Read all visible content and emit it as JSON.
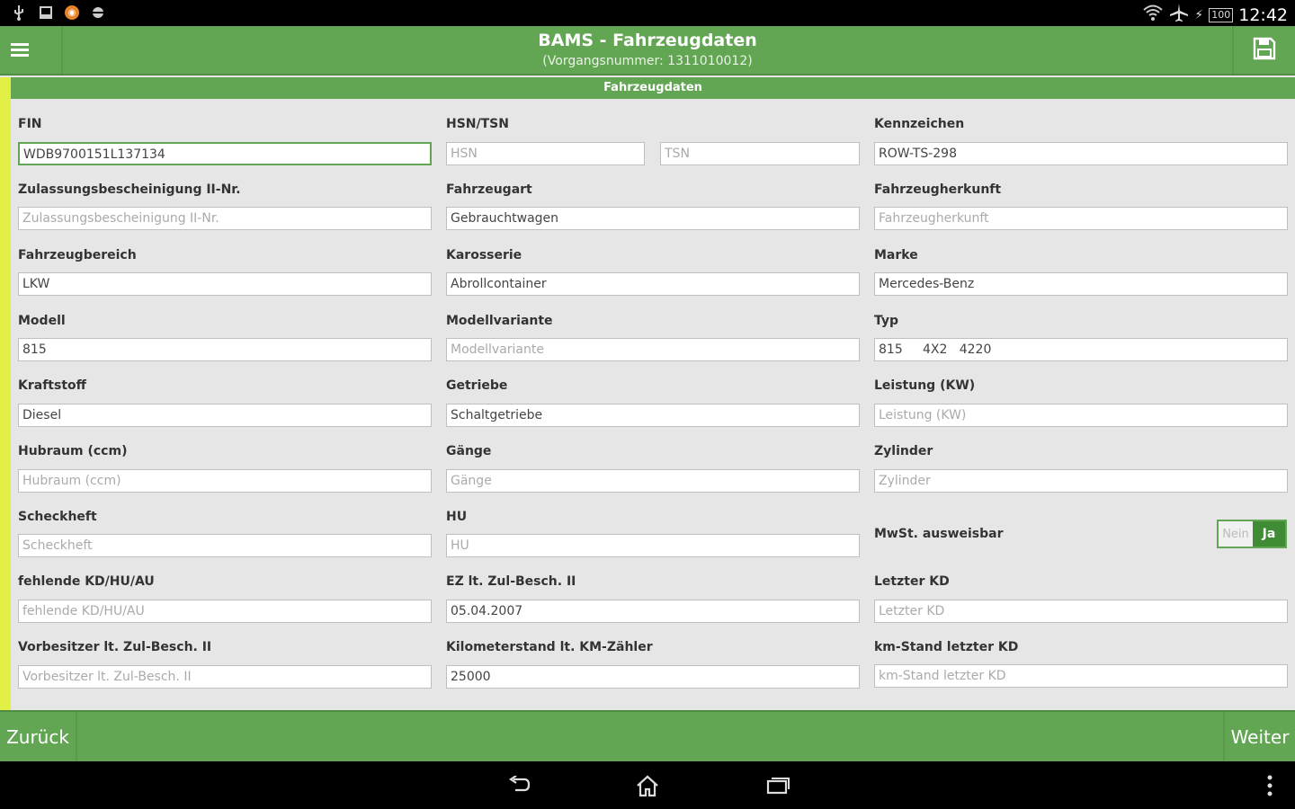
{
  "status_bar": {
    "time": "12:42",
    "battery": "100",
    "notification_icons": [
      "usb-icon",
      "download-icon",
      "app-notification-icon",
      "android-debug-icon"
    ]
  },
  "action_bar": {
    "title": "BAMS - Fahrzeugdaten",
    "subtitle": "(Vorgangsnummer: 1311010012)"
  },
  "section": {
    "title": "Fahrzeugdaten"
  },
  "fields": {
    "fin": {
      "label": "FIN",
      "value": "WDB9700151L137134"
    },
    "hsn": {
      "label": "HSN/TSN",
      "placeholder": "HSN"
    },
    "tsn": {
      "placeholder": "TSN"
    },
    "kennzeichen": {
      "label": "Kennzeichen",
      "value": "ROW-TS-298"
    },
    "zb2": {
      "label": "Zulassungsbescheinigung II-Nr.",
      "placeholder": "Zulassungsbescheinigung II-Nr."
    },
    "fahrzeugart": {
      "label": "Fahrzeugart",
      "value": "Gebrauchtwagen"
    },
    "fahrzeugherkunft": {
      "label": "Fahrzeugherkunft",
      "placeholder": "Fahrzeugherkunft"
    },
    "fahrzeugbereich": {
      "label": "Fahrzeugbereich",
      "value": "LKW"
    },
    "karosserie": {
      "label": "Karosserie",
      "value": "Abrollcontainer"
    },
    "marke": {
      "label": "Marke",
      "value": "Mercedes-Benz"
    },
    "modell": {
      "label": "Modell",
      "value": "815"
    },
    "modellvariante": {
      "label": "Modellvariante",
      "placeholder": "Modellvariante"
    },
    "typ": {
      "label": "Typ",
      "value": "815     4X2   4220"
    },
    "kraftstoff": {
      "label": "Kraftstoff",
      "value": "Diesel"
    },
    "getriebe": {
      "label": "Getriebe",
      "value": "Schaltgetriebe"
    },
    "leistung": {
      "label": "Leistung (KW)",
      "placeholder": "Leistung (KW)"
    },
    "hubraum": {
      "label": "Hubraum (ccm)",
      "placeholder": "Hubraum (ccm)"
    },
    "gaenge": {
      "label": "Gänge",
      "placeholder": "Gänge"
    },
    "zylinder": {
      "label": "Zylinder",
      "placeholder": "Zylinder"
    },
    "scheckheft": {
      "label": "Scheckheft",
      "placeholder": "Scheckheft"
    },
    "hu": {
      "label": "HU",
      "placeholder": "HU"
    },
    "mwst": {
      "label": "MwSt. ausweisbar",
      "option_no": "Nein",
      "option_yes": "Ja",
      "selected": "Ja"
    },
    "fehlende_kd": {
      "label": "fehlende KD/HU/AU",
      "placeholder": "fehlende KD/HU/AU"
    },
    "ez": {
      "label": "EZ lt. Zul-Besch. II",
      "value": "05.04.2007"
    },
    "letzter_kd": {
      "label": "Letzter KD",
      "placeholder": "Letzter KD"
    },
    "vorbesitzer": {
      "label": "Vorbesitzer lt. Zul-Besch. II",
      "placeholder": "Vorbesitzer lt. Zul-Besch. II"
    },
    "km_stand": {
      "label": "Kilometerstand lt. KM-Zähler",
      "value": "25000"
    },
    "km_letzter_kd": {
      "label": "km-Stand letzter KD",
      "placeholder": "km-Stand letzter KD"
    }
  },
  "bottom_bar": {
    "back_label": "Zurück",
    "next_label": "Weiter"
  },
  "colors": {
    "primary_green": "#62a553",
    "accent_yellow": "#e2f046",
    "toggle_active": "#3f8c35"
  }
}
